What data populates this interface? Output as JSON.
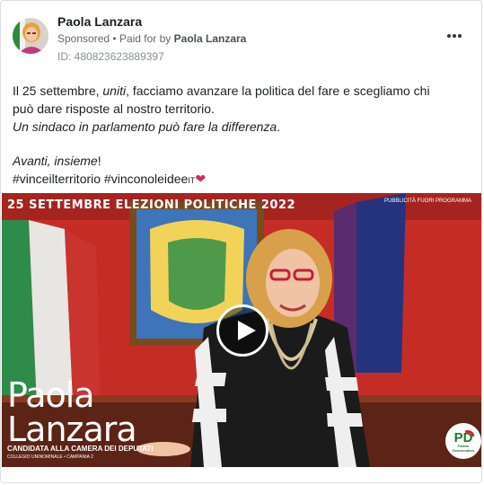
{
  "post": {
    "author_name": "Paola Lanzara",
    "sponsored_label": "Sponsored",
    "separator": "•",
    "paid_for_prefix": "Paid for by",
    "paid_for_name": "Paola Lanzara",
    "ad_id": "ID: 480823623889397",
    "more_icon": "more-dots-icon",
    "text": {
      "l1_a": "Il 25 settembre, ",
      "l1_b": "uniti",
      "l1_c": ", facciamo avanzare la politica del fare e scegliamo chi",
      "l2": "può dare risposte al nostro territorio.",
      "l3": "Un sindaco in parlamento può fare la differenza",
      "l3_end": ".",
      "l4_a": "Avanti, insieme",
      "l4_b": "!",
      "hashtags": "#vinceilterritorio #vincono​leidee",
      "it_tag": "IT",
      "heart": "❤"
    }
  },
  "video": {
    "top_caption": "25 SETTEMBRE ELEZIONI POLITICHE 2022",
    "small_credit": "PUBBLICITÀ FUORI PROGRAMMA",
    "name_line1": "Paola",
    "name_line2": "Lanzara",
    "candidate_line": "CANDIDATA ALLA CAMERA DEI DEPUTATI",
    "candidate_sub": "COLLEGIO UNINOMINALE • CAMPANIA 2",
    "play_icon": "play-icon",
    "logo_text": "PD",
    "logo_sub": "Partito Democratico"
  },
  "colors": {
    "heart": "#e0245e",
    "wall_red": "#c62c26",
    "pd_green": "#1a7a2e",
    "pd_red": "#d9232e"
  }
}
